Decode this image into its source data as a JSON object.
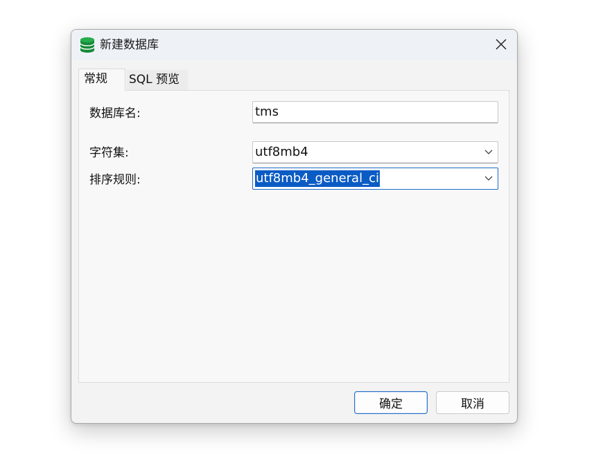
{
  "dialog": {
    "title": "新建数据库",
    "app_icon": "database-icon",
    "close_icon": "close-icon"
  },
  "tabs": [
    {
      "label": "常规",
      "active": true
    },
    {
      "label": "SQL 预览",
      "active": false
    }
  ],
  "form": {
    "db_name_label": "数据库名:",
    "db_name_value": "tms",
    "charset_label": "字符集:",
    "charset_value": "utf8mb4",
    "collation_label": "排序规则:",
    "collation_value": "utf8mb4_general_ci"
  },
  "buttons": {
    "ok_label": "确定",
    "cancel_label": "取消"
  },
  "colors": {
    "accent": "#0a5bc4",
    "icon_green": "#1a8a3a"
  }
}
